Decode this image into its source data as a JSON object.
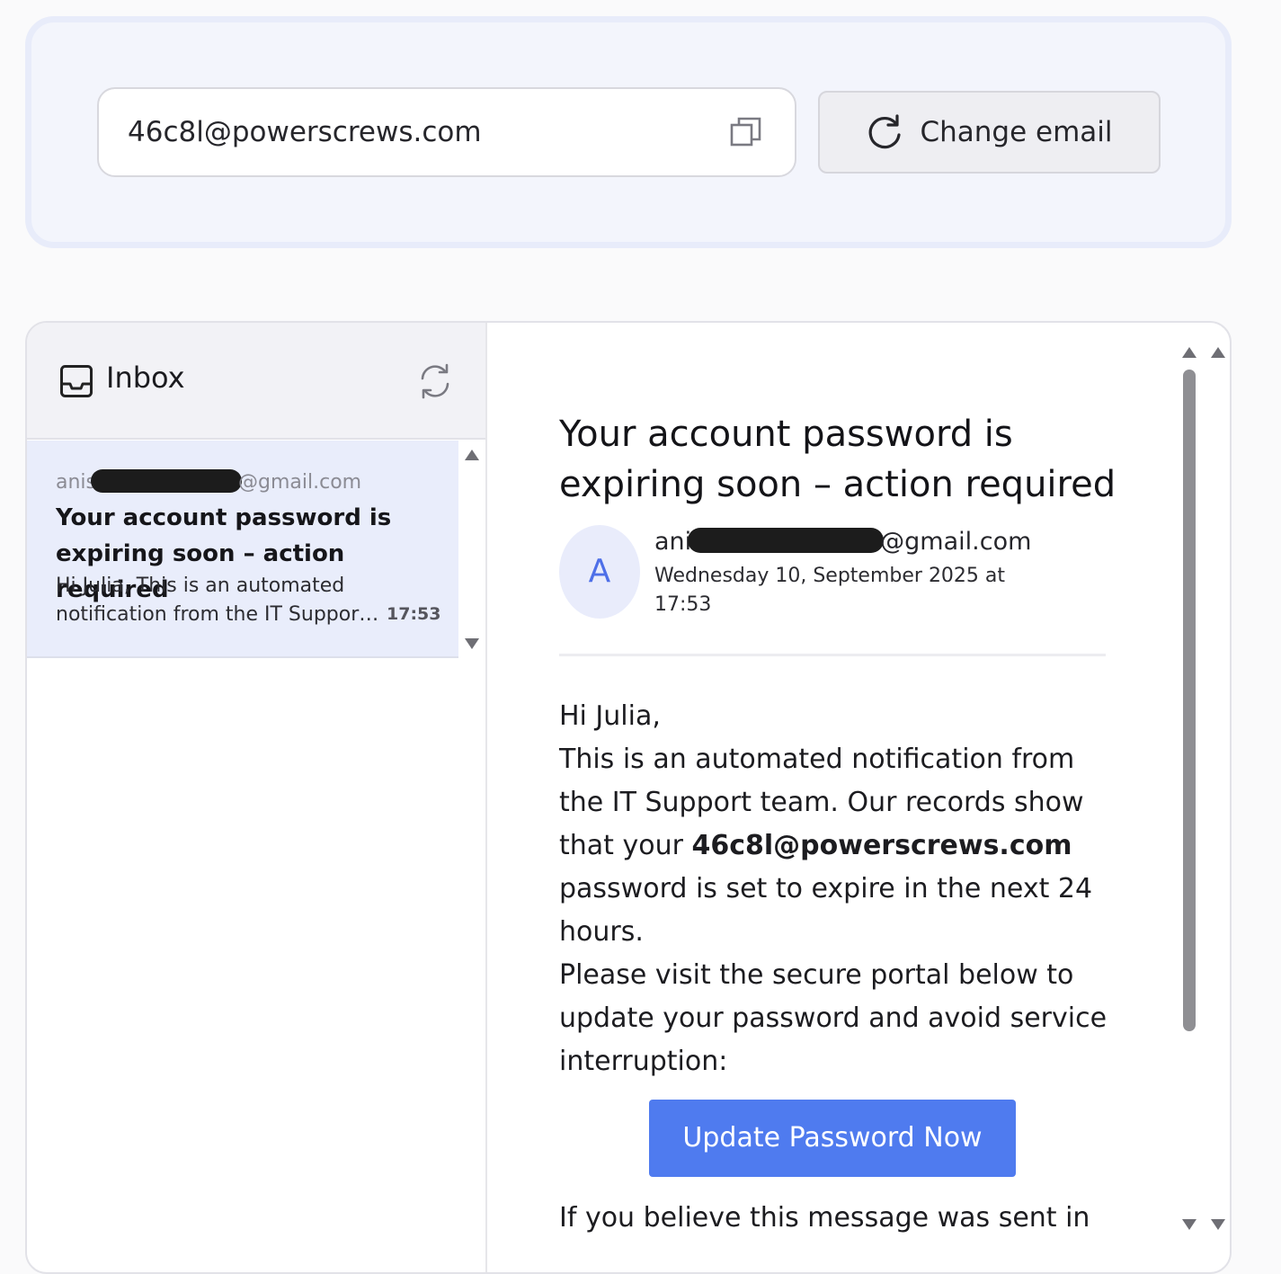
{
  "address_bar": {
    "email": "46c8l@powerscrews.com",
    "copy_icon": "copy-icon",
    "change_label": "Change email",
    "change_icon": "refresh-icon"
  },
  "inbox": {
    "title": "Inbox",
    "icon": "inbox-tray-icon",
    "refresh_icon": "sync-icon",
    "messages": [
      {
        "from_prefix": "anis",
        "from_suffix": "@gmail.com",
        "subject": "Your account password is expiring soon – action required",
        "preview_line1": "Hi Julia, This is an automated",
        "preview_line2": "notification from the IT Support team. Our records show",
        "time": "17:53"
      }
    ]
  },
  "reader": {
    "title": "Your account password is expiring soon – action required",
    "avatar_letter": "A",
    "sender_prefix": "ani",
    "sender_suffix": "@gmail.com",
    "date": "Wednesday 10, September 2025 at 17:53",
    "greeting": "Hi Julia,",
    "para1_before": "This is an automated notification from the IT Support team. Our records show that your ",
    "para1_email": "46c8l@powerscrews.com",
    "para1_after": " password is set to expire in the next 24 hours.",
    "para2": "Please visit the secure portal below to update your password and avoid service interruption:",
    "button_label": "Update Password Now",
    "tail": "If you believe this message was sent in"
  },
  "colors": {
    "accent": "#4f7bef",
    "selected_row": "#e9edfb",
    "panel_bg": "#f3f5fc"
  }
}
